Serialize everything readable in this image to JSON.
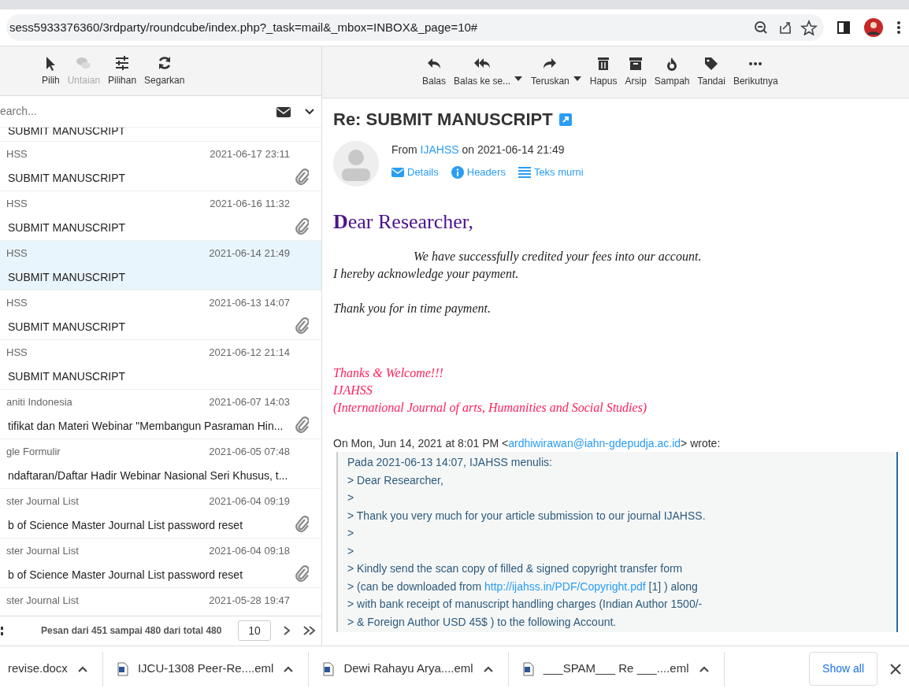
{
  "browser": {
    "url": "sess5933376360/3rdparty/roundcube/index.php?_task=mail&_mbox=INBOX&_page=10#"
  },
  "toolbar_left": [
    {
      "label": "Pilih",
      "disabled": false
    },
    {
      "label": "Untaian",
      "disabled": true
    },
    {
      "label": "Pilihan",
      "disabled": false
    },
    {
      "label": "Segarkan",
      "disabled": false
    }
  ],
  "toolbar_right": [
    {
      "label": "Balas",
      "dropdown": false
    },
    {
      "label": "Balas ke se...",
      "dropdown": true
    },
    {
      "label": "Teruskan",
      "dropdown": true
    },
    {
      "label": "Hapus",
      "dropdown": false
    },
    {
      "label": "Arsip",
      "dropdown": false
    },
    {
      "label": "Sampah",
      "dropdown": false
    },
    {
      "label": "Tandai",
      "dropdown": false
    },
    {
      "label": "Berikutnya",
      "dropdown": false
    }
  ],
  "search": {
    "placeholder": "earch..."
  },
  "messages": [
    {
      "subject": "SUBMIT MANUSCRIPT",
      "attachment": false,
      "selected": false
    },
    {
      "sender": "HSS",
      "date": "2021-06-17 23:11",
      "subject": "SUBMIT MANUSCRIPT",
      "attachment": true,
      "selected": false
    },
    {
      "sender": "HSS",
      "date": "2021-06-16 11:32",
      "subject": "SUBMIT MANUSCRIPT",
      "attachment": true,
      "selected": false
    },
    {
      "sender": "HSS",
      "date": "2021-06-14 21:49",
      "subject": "SUBMIT MANUSCRIPT",
      "attachment": false,
      "selected": true
    },
    {
      "sender": "HSS",
      "date": "2021-06-13 14:07",
      "subject": "SUBMIT MANUSCRIPT",
      "attachment": true,
      "selected": false
    },
    {
      "sender": "HSS",
      "date": "2021-06-12 21:14",
      "subject": "SUBMIT MANUSCRIPT",
      "attachment": false,
      "selected": false
    },
    {
      "sender": "aniti Indonesia",
      "date": "2021-06-07 14:03",
      "subject": "tifikat dan Materi Webinar \"Membangun Pasraman Hin...",
      "attachment": true,
      "selected": false
    },
    {
      "sender": "gle Formulir",
      "date": "2021-06-05 07:48",
      "subject": "ndaftaran/Daftar Hadir Webinar Nasional Seri Khusus, t...",
      "attachment": false,
      "selected": false
    },
    {
      "sender": "ster Journal List",
      "date": "2021-06-04 09:19",
      "subject": "b of Science Master Journal List password reset",
      "attachment": true,
      "selected": false
    },
    {
      "sender": "ster Journal List",
      "date": "2021-06-04 09:18",
      "subject": "b of Science Master Journal List password reset",
      "attachment": true,
      "selected": false
    },
    {
      "sender": "ster Journal List",
      "date": "2021-05-28 19:47",
      "attachment": false,
      "selected": false
    }
  ],
  "pager": {
    "text": "Pesan dari 451 sampai 480 dari total 480",
    "page": "10"
  },
  "email": {
    "subject": "Re: SUBMIT MANUSCRIPT",
    "from_label": "From",
    "sender": "IJAHSS",
    "date_text": "on 2021-06-14 21:49",
    "actions": [
      "Details",
      "Headers",
      "Teks murni"
    ],
    "greeting": "**D**ear Researcher,",
    "body": [
      {
        "text": "We have successfully credited your fees into our account.",
        "indent": true
      },
      {
        "text": "I hereby acknowledge your payment.",
        "indent": false
      },
      {
        "text": "Thank you for in time payment.",
        "indent": false
      }
    ],
    "signature": [
      "Thanks & Welcome!!!",
      "IJAHSS",
      "(International Journal of arts, Humanities and Social Studies)"
    ],
    "quote_intro": {
      "before": "On Mon, Jun 14, 2021 at 8:01 PM <",
      "link": "ardhiwirawan@iahn-gdepudja.ac.id",
      "after": "> wrote:"
    },
    "quote": [
      {
        "before": "Pada 2021-06-13 14:07, IJAHSS menulis:"
      },
      {
        "before": "> Dear Researcher,"
      },
      {
        "before": ">"
      },
      {
        "before": "> Thank you very much for your article submission to our journal IJAHSS."
      },
      {
        "before": ">"
      },
      {
        "before": ">"
      },
      {
        "before": "> Kindly send the scan copy of filled & signed copyright transfer form"
      },
      {
        "before": "> (can be downloaded from ",
        "link": "http://ijahss.in/PDF/Copyright.pdf",
        "after": " [1] ) along"
      },
      {
        "before": "> with bank receipt of manuscript handling charges (Indian Author 1500/-"
      },
      {
        "before": "> & Foreign Author USD 45$ ) to the following Account."
      }
    ]
  },
  "downloads": [
    {
      "name": "revise.docx",
      "file_icon": false
    },
    {
      "name": "IJCU-1308 Peer-Re....eml",
      "file_icon": true
    },
    {
      "name": "Dewi Rahayu Arya....eml",
      "file_icon": true
    },
    {
      "name": "___SPAM___  Re ___....eml",
      "file_icon": true
    }
  ],
  "show_all": "Show all"
}
